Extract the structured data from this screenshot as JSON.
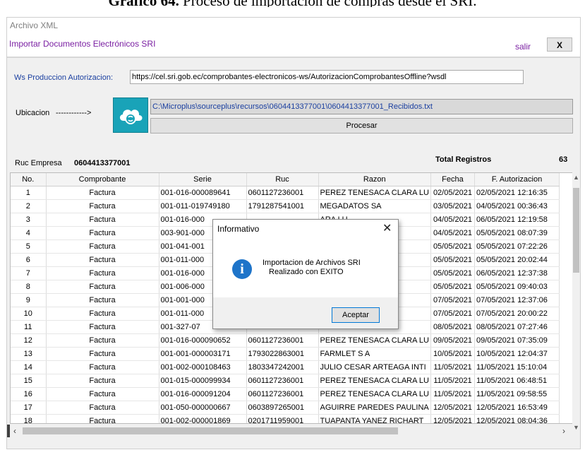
{
  "caption": {
    "bold": "Gráfico 64.",
    "rest": "Proceso de importación de compras desde el SRI."
  },
  "window": {
    "title": "Archivo XML",
    "header_title": "Importar Documentos Electrónicos SRI",
    "salir_label": "salir",
    "close_label": "X"
  },
  "form": {
    "ws_label": "Ws Produccion Autorizacion:",
    "ws_value": "https://cel.sri.gob.ec/comprobantes-electronicos-ws/AutorizacionComprobantesOffline?wsdl",
    "ubicacion_label": "Ubicacion",
    "arrow_label": "------------>",
    "path_value": "C:\\Microplus\\sourceplus\\recursos\\0604413377001\\0604413377001_Recibidos.txt",
    "procesar_label": "Procesar",
    "cloud_icon": "cloud-sync-icon"
  },
  "summary": {
    "ruc_label": "Ruc Empresa",
    "ruc_value": "0604413377001",
    "total_label": "Total Registros",
    "total_value": "63"
  },
  "table": {
    "headers": [
      "No.",
      "Comprobante",
      "Serie",
      "Ruc",
      "Razon",
      "Fecha",
      "F. Autorizacion"
    ],
    "rows": [
      [
        "1",
        "Factura",
        "001-016-000089641",
        "0601127236001",
        "PEREZ TENESACA CLARA LU",
        "02/05/2021",
        "02/05/2021 12:16:35"
      ],
      [
        "2",
        "Factura",
        "001-011-019749180",
        "1791287541001",
        "MEGADATOS SA",
        "03/05/2021",
        "04/05/2021 00:36:43"
      ],
      [
        "3",
        "Factura",
        "001-016-000",
        "",
        "ARA LU",
        "04/05/2021",
        "06/05/2021 12:19:58"
      ],
      [
        "4",
        "Factura",
        "003-901-000",
        "",
        "NTRO A",
        "04/05/2021",
        "05/05/2021 08:07:39"
      ],
      [
        "5",
        "Factura",
        "001-041-001",
        "",
        "A RIOBA",
        "05/05/2021",
        "05/05/2021 07:22:26"
      ],
      [
        "6",
        "Factura",
        "001-011-000",
        "",
        "ERINAR",
        "05/05/2021",
        "05/05/2021 20:02:44"
      ],
      [
        "7",
        "Factura",
        "001-016-000",
        "",
        "ARA LU",
        "05/05/2021",
        "06/05/2021 12:37:38"
      ],
      [
        "8",
        "Factura",
        "001-006-000",
        "",
        "MO DES",
        "05/05/2021",
        "05/05/2021 09:40:03"
      ],
      [
        "9",
        "Factura",
        "001-001-000",
        "",
        "L AGRC",
        "07/05/2021",
        "07/05/2021 12:37:06"
      ],
      [
        "10",
        "Factura",
        "001-011-000",
        "",
        "ERINAR",
        "07/05/2021",
        "07/05/2021 20:00:22"
      ],
      [
        "11",
        "Factura",
        "001-327-07",
        "",
        "",
        "08/05/2021",
        "08/05/2021 07:27:46"
      ],
      [
        "12",
        "Factura",
        "001-016-000090652",
        "0601127236001",
        "PEREZ TENESACA CLARA LU",
        "09/05/2021",
        "09/05/2021 07:35:09"
      ],
      [
        "13",
        "Factura",
        "001-001-000003171",
        "1793022863001",
        "FARMLET S A",
        "10/05/2021",
        "10/05/2021 12:04:37"
      ],
      [
        "14",
        "Factura",
        "001-002-000108463",
        "1803347242001",
        "JULIO CESAR ARTEAGA INTI",
        "11/05/2021",
        "11/05/2021 15:10:04"
      ],
      [
        "15",
        "Factura",
        "001-015-000099934",
        "0601127236001",
        "PEREZ TENESACA CLARA LU",
        "11/05/2021",
        "11/05/2021 06:48:51"
      ],
      [
        "16",
        "Factura",
        "001-016-000091204",
        "0601127236001",
        "PEREZ TENESACA CLARA LU",
        "11/05/2021",
        "11/05/2021 09:58:55"
      ],
      [
        "17",
        "Factura",
        "001-050-000000667",
        "0603897265001",
        "AGUIRRE PAREDES PAULINA",
        "12/05/2021",
        "12/05/2021 16:53:49"
      ],
      [
        "18",
        "Factura",
        "001-002-000001869",
        "0201711959001",
        "TUAPANTA YANEZ RICHART",
        "12/05/2021",
        "12/05/2021 08:04:36"
      ]
    ]
  },
  "dialog": {
    "title": "Informativo",
    "close_label": "✕",
    "icon": "info-icon",
    "message_line1": "Importacion de Archivos SRI",
    "message_line2": "Realizado con EXITO",
    "ok_label": "Aceptar"
  },
  "colors": {
    "accent": "#7a1fa2",
    "link": "#1a3fa0",
    "cloud": "#19a3b8",
    "info": "#1e74c9"
  }
}
